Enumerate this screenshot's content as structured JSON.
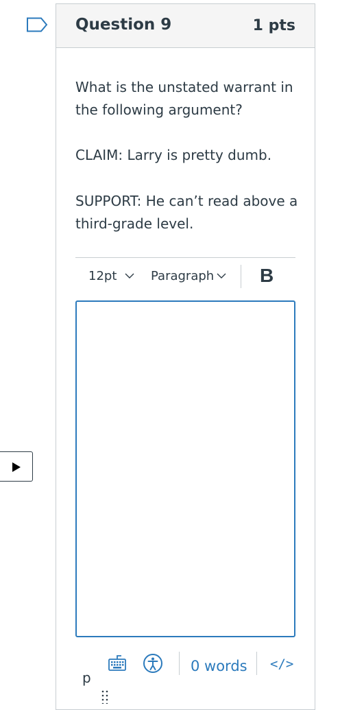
{
  "question": {
    "title": "Question 9",
    "points": "1 pts",
    "prompt_line1": "What is the unstated warrant in the following argument?",
    "claim": "CLAIM: Larry is pretty dumb.",
    "support": "SUPPORT: He can’t read above a third-grade level."
  },
  "toolbar": {
    "font_size": "12pt",
    "block_format": "Paragraph",
    "bold_label": "B"
  },
  "editor": {
    "content": ""
  },
  "statusbar": {
    "path": "p",
    "word_count": "0 words",
    "html_toggle": "</>"
  },
  "icons": {
    "flag": "flag-icon",
    "play": "play-icon",
    "keyboard": "keyboard-icon",
    "accessibility": "accessibility-icon",
    "resize": "resize-grip-icon"
  },
  "colors": {
    "accent": "#2b7abc",
    "text": "#2d3b45",
    "border": "#c7cdd1",
    "header_bg": "#f5f5f5"
  }
}
